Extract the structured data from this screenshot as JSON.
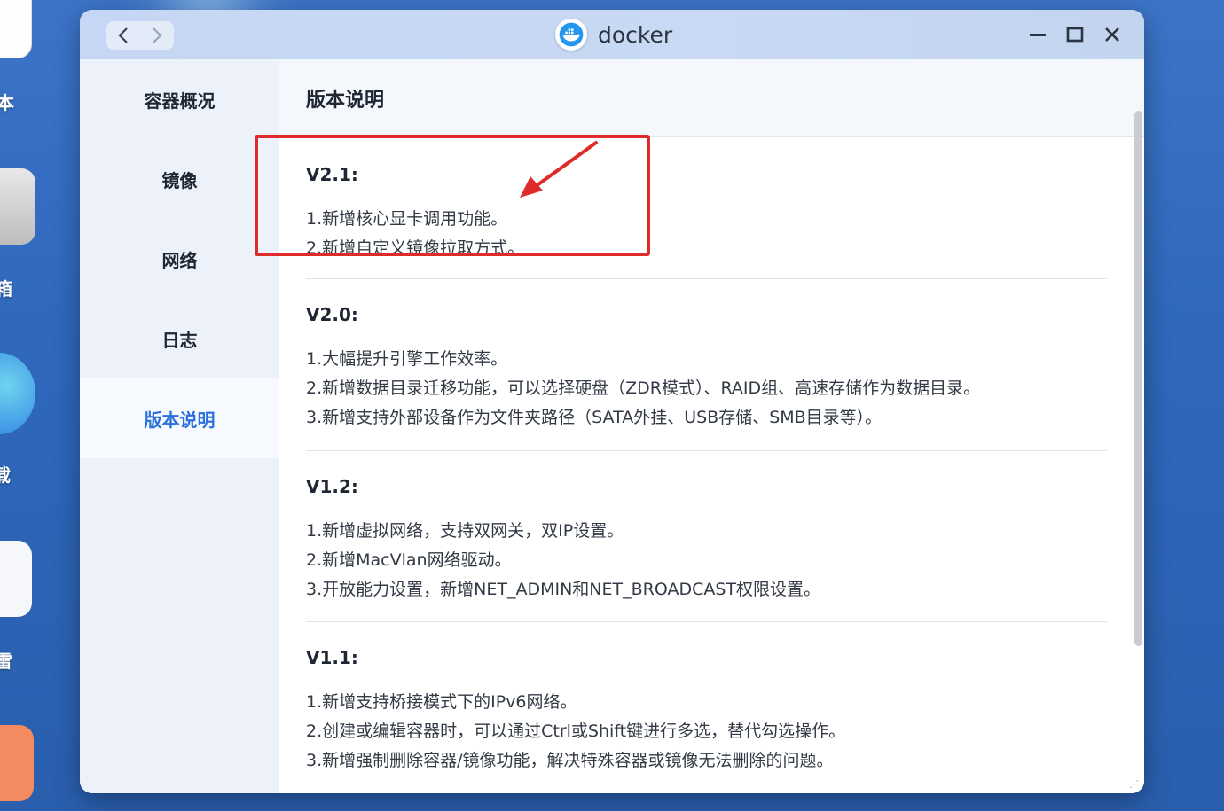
{
  "desktop": {
    "labels": [
      "本",
      "箱",
      "载",
      "雷"
    ]
  },
  "window": {
    "title": "docker",
    "back_label": "back",
    "forward_label": "forward"
  },
  "sidebar": {
    "items": [
      {
        "label": "容器概况"
      },
      {
        "label": "镜像"
      },
      {
        "label": "网络"
      },
      {
        "label": "日志"
      },
      {
        "label": "版本说明"
      }
    ],
    "active_index": 4
  },
  "main": {
    "header": "版本说明",
    "versions": [
      {
        "version": "V2.1:",
        "notes": [
          "1.新增核心显卡调用功能。",
          "2.新增自定义镜像拉取方式。"
        ]
      },
      {
        "version": "V2.0:",
        "notes": [
          "1.大幅提升引擎工作效率。",
          "2.新增数据目录迁移功能，可以选择硬盘（ZDR模式）、RAID组、高速存储作为数据目录。",
          "3.新增支持外部设备作为文件夹路径（SATA外挂、USB存储、SMB目录等）。"
        ]
      },
      {
        "version": "V1.2:",
        "notes": [
          "1.新增虚拟网络，支持双网关，双IP设置。",
          "2.新增MacVlan网络驱动。",
          "3.开放能力设置，新增NET_ADMIN和NET_BROADCAST权限设置。"
        ]
      },
      {
        "version": "V1.1:",
        "notes": [
          "1.新增支持桥接模式下的IPv6网络。",
          "2.创建或编辑容器时，可以通过Ctrl或Shift键进行多选，替代勾选操作。",
          "3.新增强制删除容器/镜像功能，解决特殊容器或镜像无法删除的问题。"
        ]
      }
    ]
  },
  "colors": {
    "accent": "#2a6fdb",
    "highlight": "#e02b2b"
  }
}
